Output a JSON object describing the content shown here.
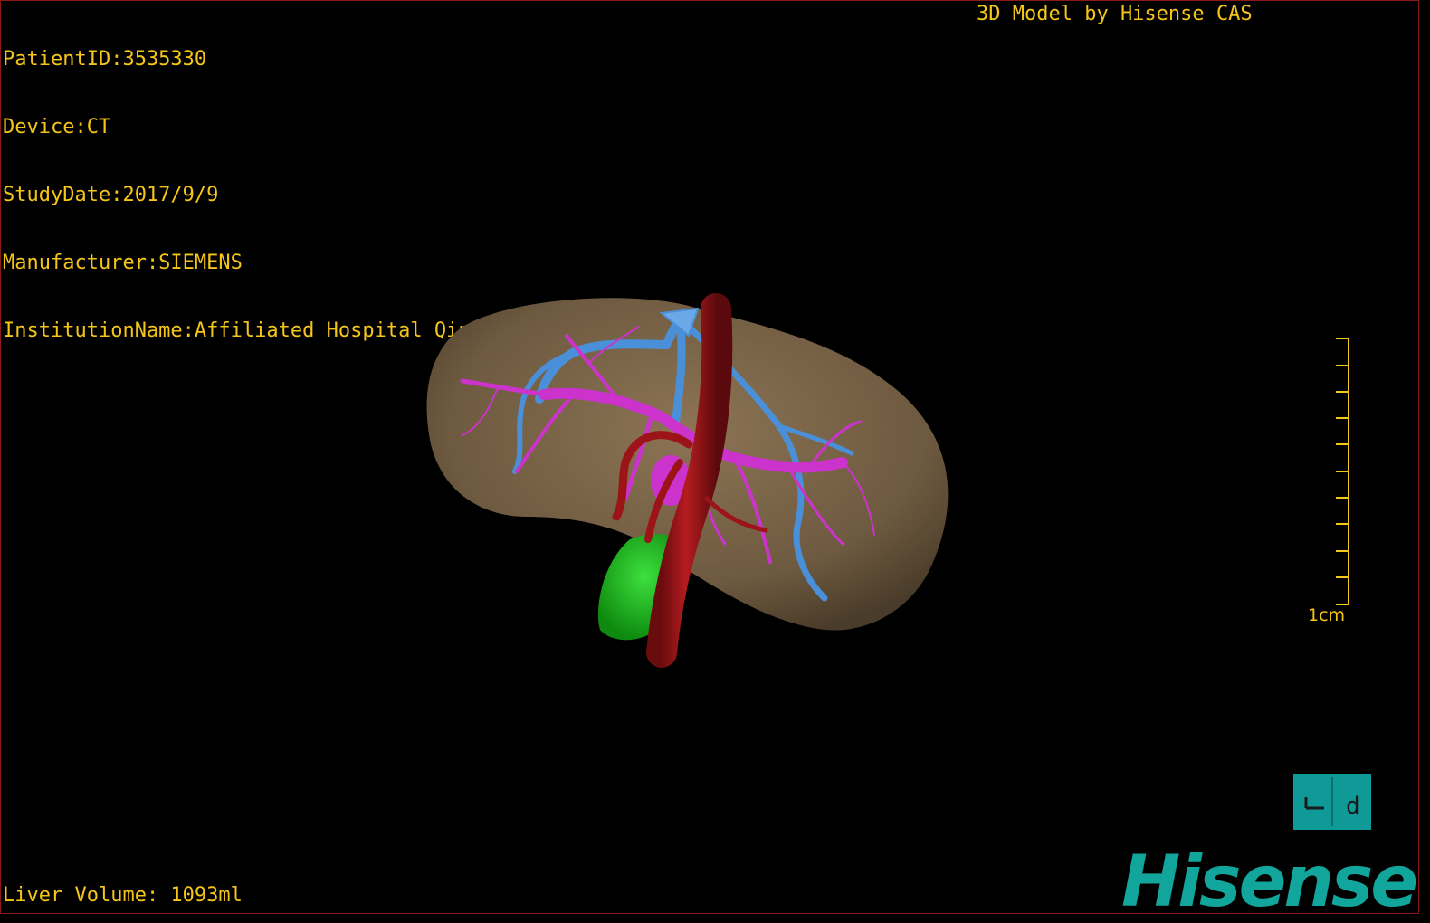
{
  "overlay": {
    "patient_id": "PatientID:3535330",
    "device": "Device:CT",
    "study_date": "StudyDate:2017/9/9",
    "manufacturer": "Manufacturer:SIEMENS",
    "institution": "InstitutionName:Affiliated Hospital Qingdao University-C",
    "model_credit": "3D Model by Hisense CAS",
    "liver_volume": "Liver Volume: 1093ml"
  },
  "scale_bar": {
    "label": "1cm",
    "tick_count": 11
  },
  "orientation_marker": {
    "glyphs": "L P"
  },
  "logo": {
    "text": "Hisense"
  },
  "colors": {
    "overlay_text": "#f5c518",
    "liver": "#7a6448",
    "portal_vein": "#cc33cc",
    "hepatic_vein": "#4a90d9",
    "artery": "#9c1418",
    "gallbladder": "#1fb81f",
    "brand": "#12a59b",
    "viewport_border": "#8a1a1a"
  },
  "icons": {
    "orientation": "orientation-cube-icon"
  }
}
